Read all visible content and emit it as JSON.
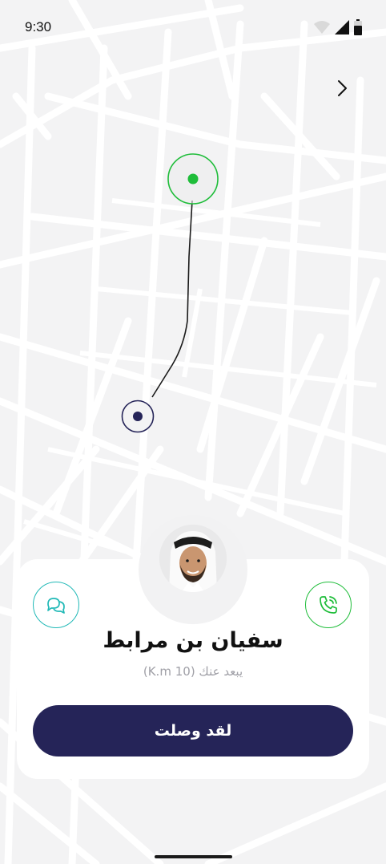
{
  "status_bar": {
    "time": "9:30"
  },
  "driver": {
    "name": "سفيان بن مرابط",
    "distance_text": "يبعد عنك (10 K.m)"
  },
  "actions": {
    "arrived_label": "لقد وصلت"
  },
  "icons": {
    "back": "chevron-right-icon",
    "chat": "chat-bubbles-icon",
    "call": "phone-call-icon",
    "wifi": "wifi-icon",
    "signal": "signal-icon",
    "battery": "battery-icon"
  },
  "colors": {
    "primary": "#252458",
    "pickup_marker": "#1fbd3a",
    "chat_accent": "#21b9b7",
    "call_accent": "#1fbd3a"
  }
}
